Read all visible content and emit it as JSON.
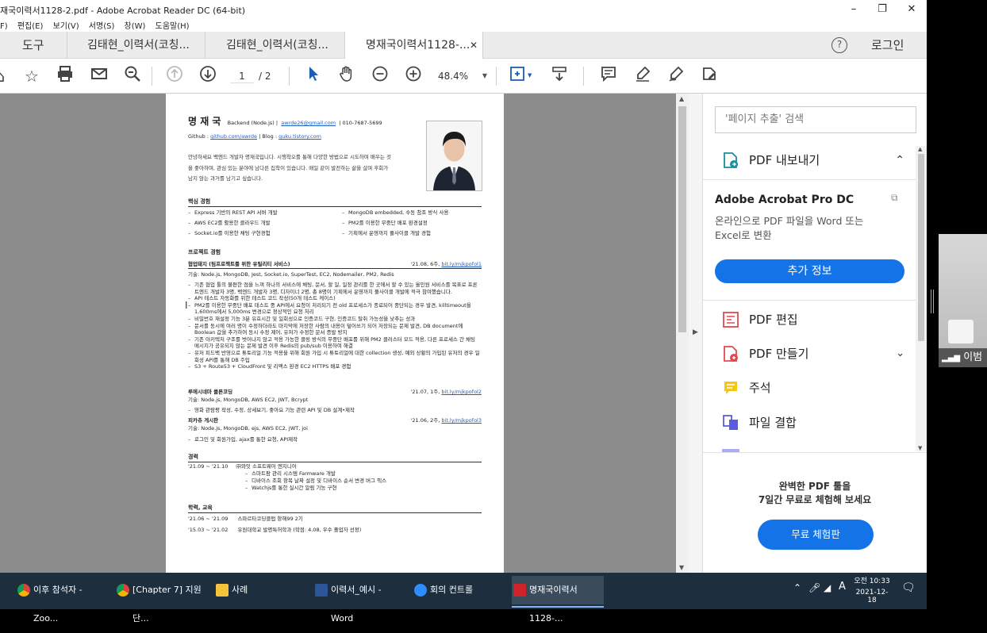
{
  "window": {
    "title": "재국이력서1128-2.pdf - Adobe Acrobat Reader DC (64-bit)"
  },
  "menu": [
    "F)",
    "편집(E)",
    "보기(V)",
    "서명(S)",
    "창(W)",
    "도움말(H)"
  ],
  "tabs": {
    "tools": "도구",
    "tab1": "김태현_이력서(코칭...",
    "tab2": "김태현_이력서(코칭...",
    "tab3": "명재국이력서1128-...",
    "help": "?",
    "login": "로그인"
  },
  "toolbar": {
    "page_current": "1",
    "page_total": "/ 2",
    "zoom": "48.4%"
  },
  "resume": {
    "name": "명 재 국",
    "headline": "Backend (Node.js) |",
    "email": "awrde26@gmail.com",
    "phone": "| 010-7687-5699",
    "github_label": "Github :",
    "github_url": "github.com/awrde",
    "blog_label": "| Blog :",
    "blog_url": "guku.tistory.com",
    "intro": "안녕하세요 백엔드 개발자 명재국입니다. 시행착오를 통해 다양한 방법으로 시도하며 배우는 것을 좋아하며, 관심 있는 분야에 남다른 집착이 있습니다. 매일 같이 발전하는 삶을 살며 후회가 남지 않는 과거를 남기고 싶습니다.",
    "core_title": "핵심 경험",
    "core_left": [
      "Express 기반의 REST API 서버 개발",
      "AWS EC2를 활용한 클라우드 개발",
      "Socket.io를 이용한 채팅 구현경험"
    ],
    "core_right": [
      "MongoDB embedded, 수동 참조 방식 사용",
      "PM2를 이용한 무중단 배포 환경설정",
      "기획에서 운영까지 풀사이클 개발 경험"
    ],
    "proj_title": "프로젝트 경험",
    "p1_title": "협업돼지 (팀프로젝트를 위한 유틸리티 서비스)",
    "p1_date": "'21.08, 6주,",
    "p1_link": "bit.ly/mjkpofol1",
    "p1_stack": "기술: Node.js, MongoDB, Jest, Socket.io, SuperTest, EC2, Nodemailer, PM2, Redis",
    "p1_items": [
      "기존 협업 툴의 불편한 점을 느껴 하나의 서비스에 채팅, 문서, 할 일, 일정 관리를 한 곳에서 할 수 있는 올인원 서비스를 목표로 프론트엔드 개발자 3명, 백엔드 개발자 3명, 디자이너 2명, 총 8명이 기획에서 운영까지 풀사이클 개발에 적극 참여했습니다.",
      "API 테스트 자동화를 위한 테스트 코드 작성(50개 테스트 케이스)",
      "PM2를 이용한 무중단 배포 테스트 중 API에서 요청이 처리되기 전 old 프로세스가 종료되어 중단되는 경우 발견, killtimeout을 1,600ms에서 5,000ms 변경으로 정상적인 요청 처리",
      "비밀번호 재설정 기능 3분 유효시간 및 일회성으로 인증코드 구현, 인증코드 탈취 가능성을 낮추는 성과",
      "문서를 동시에 여러 명이 수정하더라도 마지막에 저장한 사람의 내용이 덮어쓰기 되어 저장되는 문제 발견, DB document에 Boolean 값을 추가하여 동시 수정 제어, 유저가 수정한 문서 증발 방지",
      "기존 아키텍처 구조를 벗어나지 않고 적용 가능한 클링 방식의 무중단 배포를 위해 PM2 클러스터 모드 적용, 다른 프로세스 간 채팅 메시지가 공유되지 않는 문제 발견 이후 Redis의 pub/sub 이용하여 해결",
      "유저 피드백 반영으로 튜토리얼 기능 적용을 위해 회원 가입 시 튜토리얼에 대한 collection 생성, 예외 상황의 가입된 유저의 경우 일회성 API를 통해 DB 주입",
      "S3 + Route53 + CloudFront 및 리액스 환경 EC2 HTTPS 배포 경험"
    ],
    "p2_title": "루에시네마 클론코딩",
    "p2_date": "'21.07, 1주,",
    "p2_link": "bit.ly/mjkpofol2",
    "p2_stack": "기술: Node.js, MongoDB, AWS EC2, JWT, Bcrypt",
    "p2_items": [
      "영화 관람평 작성, 수정, 상세보기, 좋아요 기능 관련 API 및 DB 설계•제작"
    ],
    "p3_title": "피카츄 게시판",
    "p3_date": "'21.06, 2주,",
    "p3_link": "bit.ly/mjkpofol3",
    "p3_stack": "기술: Node.js, MongoDB, ejs, AWS EC2, JWT, joi",
    "p3_items": [
      "로그인 및 회원가입, ajax를 통한 요청, API제작"
    ],
    "career_title": "경력",
    "career_period": "'21.09 ~ '21.10",
    "career_company": "㈜와잇 소프트웨어 엔지니어",
    "career_items": [
      "스마트팜 관리 시스템 Farmware 개발",
      "디바이스 조회 항목 날짜 설정 및 디바이스 순서 변경 버그 픽스",
      "Watchjs를 통한 실시간 알림 기능 구현"
    ],
    "edu_title": "학력, 교육",
    "edu": [
      {
        "period": "'21.06 ~ '21.09",
        "desc": "스파르타코딩클럽 항해99 2기"
      },
      {
        "period": "'15.03 ~ '21.02",
        "desc": "유원대학교 발명특허학과 (학점: 4.08, 우수 졸업자 선정)"
      }
    ]
  },
  "panel": {
    "search_placeholder": "'페이지 추출' 검색",
    "export_label": "PDF 내보내기",
    "product": "Adobe Acrobat Pro DC",
    "product_desc": "온라인으로 PDF 파일을 Word 또는 Excel로 변환",
    "more_info": "추가 정보",
    "items": [
      "PDF 편집",
      "PDF 만들기",
      "주석",
      "파일 결합"
    ],
    "promo_line1": "완벽한 PDF 툴을",
    "promo_line2": "7일간 무료로 체험해 보세요",
    "trial_button": "무료 체험판"
  },
  "taskbar": {
    "tasks": [
      "이후 참석자 - Zoo...",
      "[Chapter 7] 지원단...",
      "사례",
      "이력서_예시 - Word",
      "회의 컨트롤",
      "명재국이력서1128-..."
    ],
    "time": "오전 10:33",
    "date": "2021-12-18",
    "ime": "A"
  },
  "cam": {
    "name": "이범"
  }
}
